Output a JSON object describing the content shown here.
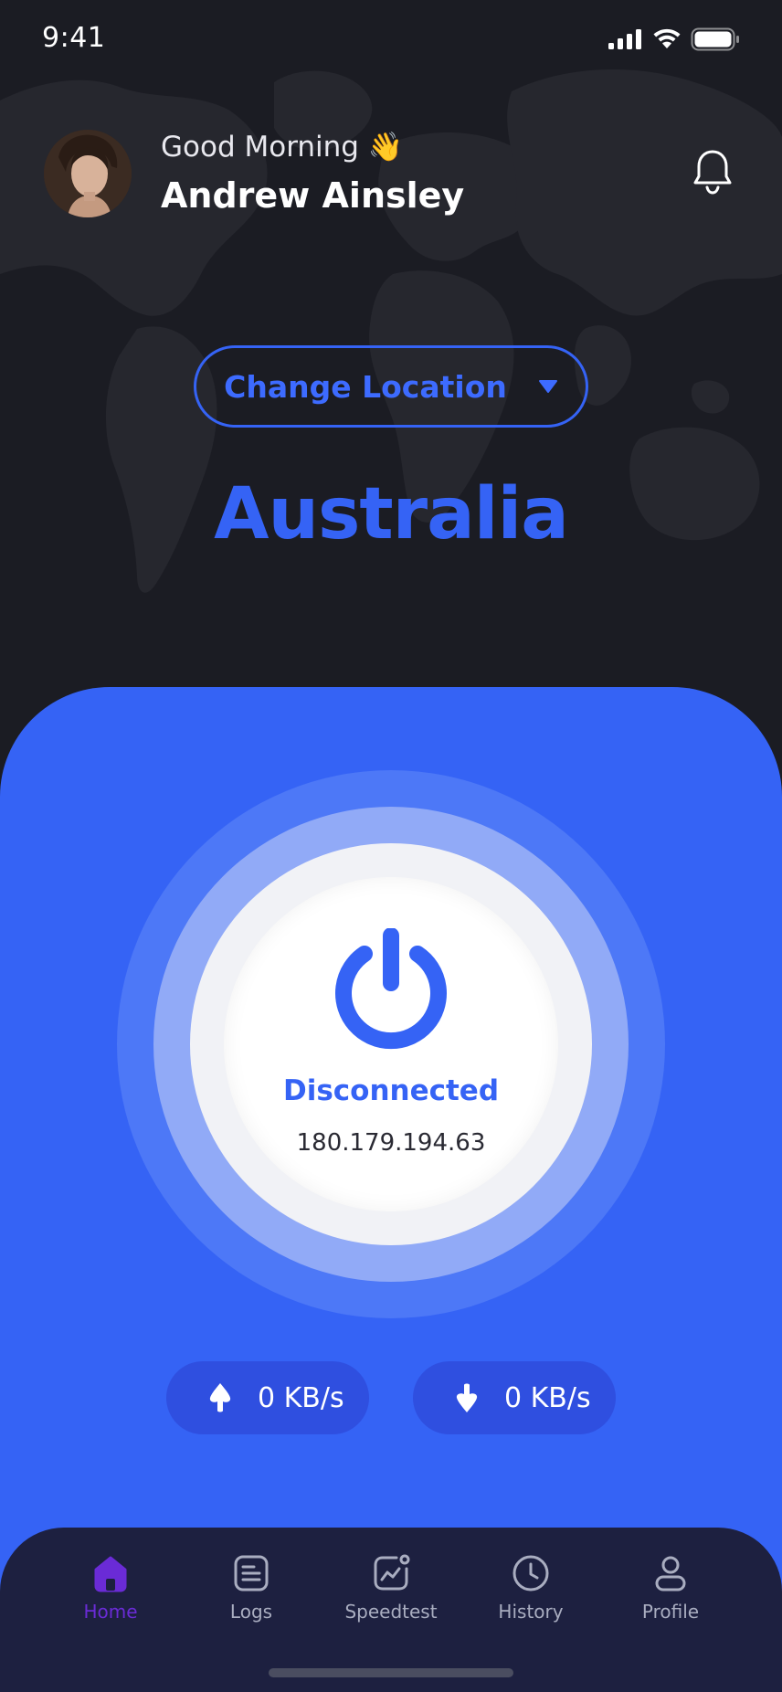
{
  "status_bar": {
    "time": "9:41"
  },
  "header": {
    "greeting": "Good Morning 👋",
    "name": "Andrew Ainsley",
    "avatar": "user-avatar",
    "bell": "bell-icon"
  },
  "location": {
    "button_label": "Change Location",
    "country": "Australia"
  },
  "connection": {
    "status": "Disconnected",
    "ip": "180.179.194.63"
  },
  "speeds": {
    "upload": "0 KB/s",
    "download": "0 KB/s"
  },
  "tabs": [
    {
      "label": "Home",
      "icon": "home-icon",
      "active": true
    },
    {
      "label": "Logs",
      "icon": "logs-icon",
      "active": false
    },
    {
      "label": "Speedtest",
      "icon": "speedtest-icon",
      "active": false
    },
    {
      "label": "History",
      "icon": "clock-icon",
      "active": false
    },
    {
      "label": "Profile",
      "icon": "profile-icon",
      "active": false
    }
  ],
  "colors": {
    "background": "#1b1c23",
    "accent": "#3563f5",
    "tabbar": "#1d2040",
    "active_tab": "#6a2bd6"
  }
}
